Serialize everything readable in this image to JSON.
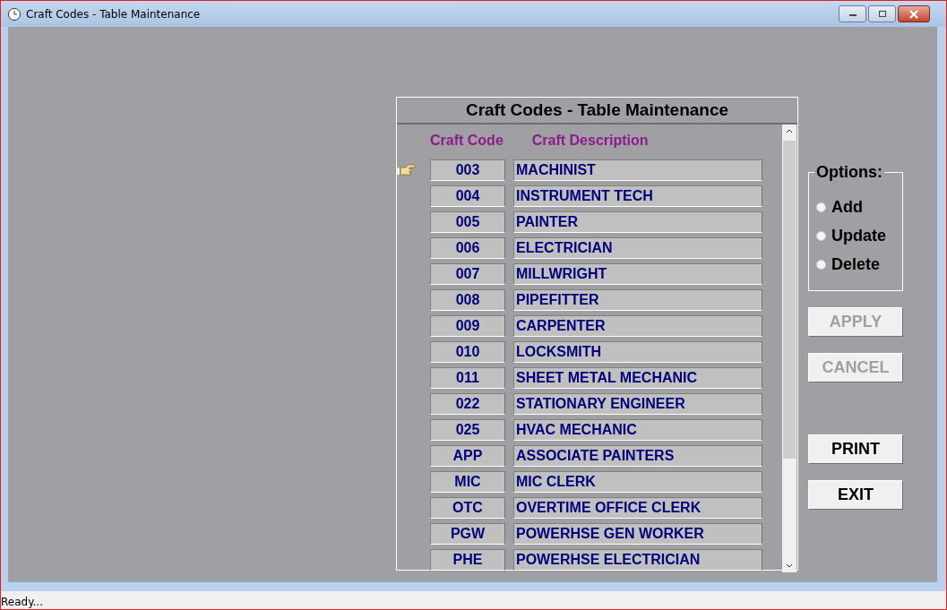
{
  "window": {
    "title": "Craft Codes - Table Maintenance"
  },
  "panel": {
    "title": "Craft Codes - Table Maintenance",
    "columns": [
      "Craft Code",
      "Craft Description"
    ],
    "rows": [
      {
        "code": "003",
        "description": "MACHINIST",
        "current": true
      },
      {
        "code": "004",
        "description": "INSTRUMENT TECH",
        "current": false
      },
      {
        "code": "005",
        "description": "PAINTER",
        "current": false
      },
      {
        "code": "006",
        "description": "ELECTRICIAN",
        "current": false
      },
      {
        "code": "007",
        "description": "MILLWRIGHT",
        "current": false
      },
      {
        "code": "008",
        "description": "PIPEFITTER",
        "current": false
      },
      {
        "code": "009",
        "description": "CARPENTER",
        "current": false
      },
      {
        "code": "010",
        "description": "LOCKSMITH",
        "current": false
      },
      {
        "code": "011",
        "description": "SHEET METAL MECHANIC",
        "current": false
      },
      {
        "code": "022",
        "description": "STATIONARY ENGINEER",
        "current": false
      },
      {
        "code": "025",
        "description": "HVAC MECHANIC",
        "current": false
      },
      {
        "code": "APP",
        "description": "ASSOCIATE PAINTERS",
        "current": false
      },
      {
        "code": "MIC",
        "description": "MIC CLERK",
        "current": false
      },
      {
        "code": "OTC",
        "description": "OVERTIME OFFICE CLERK",
        "current": false
      },
      {
        "code": "PGW",
        "description": "POWERHSE GEN WORKER",
        "current": false
      },
      {
        "code": "PHE",
        "description": "POWERHSE ELECTRICIAN",
        "current": false
      }
    ]
  },
  "options": {
    "label": "Options:",
    "items": [
      {
        "label": "Add",
        "selected": false
      },
      {
        "label": "Update",
        "selected": false
      },
      {
        "label": "Delete",
        "selected": false
      }
    ]
  },
  "buttons": [
    {
      "label": "APPLY",
      "disabled": true
    },
    {
      "label": "CANCEL",
      "disabled": true
    },
    {
      "label": "PRINT",
      "disabled": false
    },
    {
      "label": "EXIT",
      "disabled": false
    }
  ],
  "status_bar": "Ready..."
}
